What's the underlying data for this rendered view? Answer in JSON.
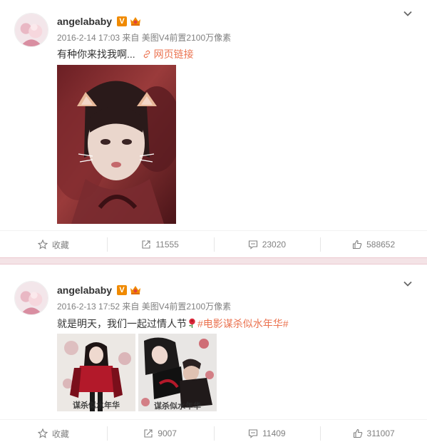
{
  "posts": [
    {
      "username": "angelababy",
      "verified_badge": "V",
      "timestamp": "2016-2-14 17:03",
      "source_prefix": "来自",
      "source": "美图V4前置2100万像素",
      "text": "有种你来找我啊...",
      "weblink_label": "网页链接",
      "actions": {
        "favorite_label": "收藏",
        "repost_count": "11555",
        "comment_count": "23020",
        "like_count": "588652"
      }
    },
    {
      "username": "angelababy",
      "verified_badge": "V",
      "timestamp": "2016-2-13 17:52",
      "source_prefix": "来自",
      "source": "美图V4前置2100万像素",
      "text": "就是明天，我们一起过情人节",
      "hashtag": "#电影谋杀似水年华#",
      "actions": {
        "favorite_label": "收藏",
        "repost_count": "9007",
        "comment_count": "11409",
        "like_count": "311007"
      }
    }
  ],
  "colors": {
    "accent": "#eb7350",
    "badge": "#f08a00",
    "muted_text": "#808080",
    "separator": "#f4e3e6"
  },
  "icons": {
    "menu": "chevron-down-icon",
    "favorite": "star-icon",
    "repost": "repost-icon",
    "comment": "comment-icon",
    "like": "thumbs-up-icon",
    "link": "link-icon",
    "emoji": "rose-icon"
  }
}
